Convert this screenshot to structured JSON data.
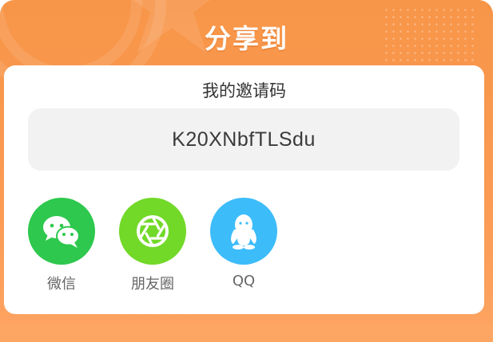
{
  "dialog": {
    "title": "分享到",
    "accent_color": "#f7964a"
  },
  "invite": {
    "heading": "我的邀请码",
    "code": "K20XNbfTLSdu"
  },
  "share_targets": [
    {
      "label": "微信",
      "icon": "wechat-icon",
      "color": "#2dc84d"
    },
    {
      "label": "朋友圈",
      "icon": "moments-aperture-icon",
      "color": "#72d928"
    },
    {
      "label": "QQ",
      "icon": "qq-penguin-icon",
      "color": "#3dbcfa"
    }
  ]
}
